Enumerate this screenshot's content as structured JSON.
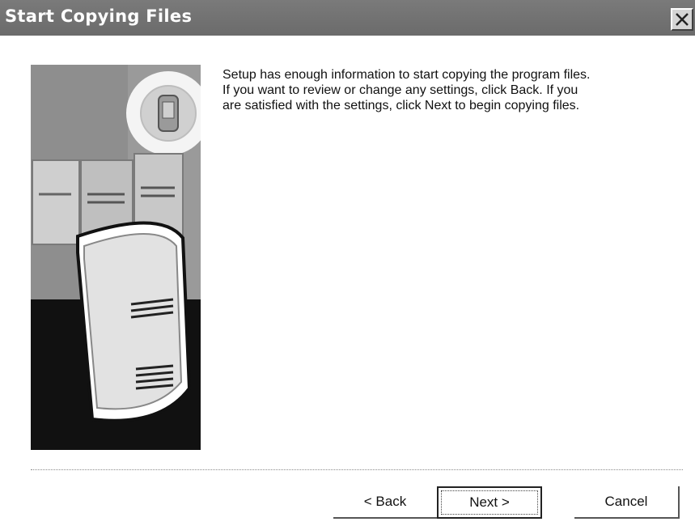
{
  "window": {
    "title": "Start Copying Files",
    "close_icon": "close-icon"
  },
  "main": {
    "illustration_icon": "server-computers-illustration",
    "message_lines": [
      "Setup has enough information to start copying the program files.",
      "If you want to review or change any settings, click Back.  If you",
      "are satisfied with the settings, click Next to begin copying files."
    ]
  },
  "footer": {
    "back_label": "< Back",
    "next_label": "Next >",
    "cancel_label": "Cancel"
  },
  "colors": {
    "titlebar": "#6b6b6b",
    "title_text": "#ffffff",
    "button_border": "#555555"
  }
}
